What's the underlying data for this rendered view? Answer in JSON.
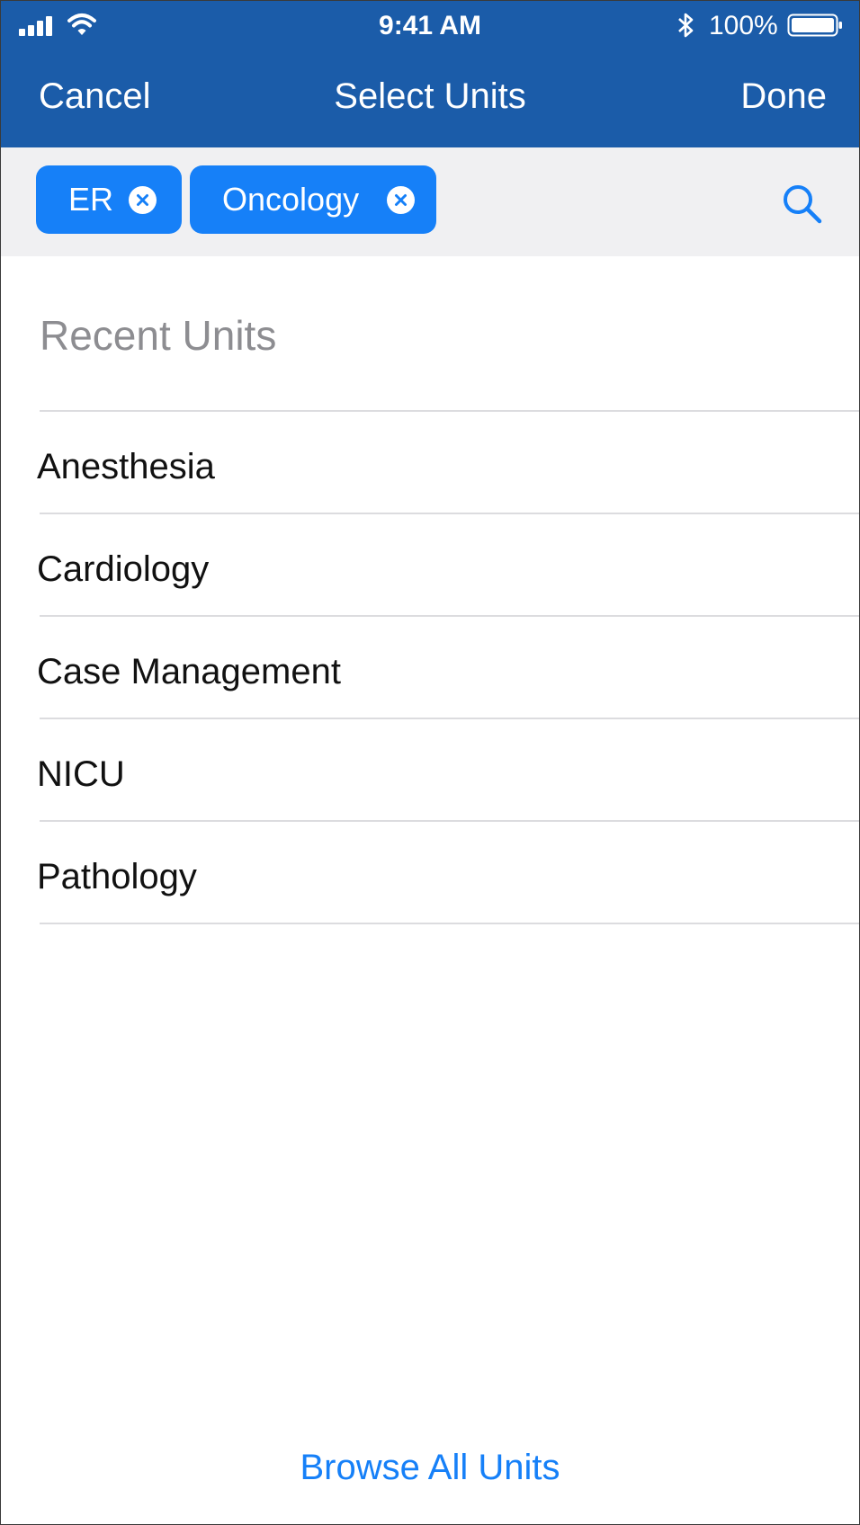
{
  "status_bar": {
    "time": "9:41 AM",
    "battery_percent": "100%",
    "icons": [
      "signal-icon",
      "wifi-icon",
      "bluetooth-icon",
      "battery-icon"
    ]
  },
  "nav": {
    "cancel_label": "Cancel",
    "title": "Select Units",
    "done_label": "Done"
  },
  "selected_units": [
    {
      "label": "ER"
    },
    {
      "label": "Oncology"
    }
  ],
  "recent": {
    "header": "Recent Units",
    "items": [
      {
        "label": "Anesthesia"
      },
      {
        "label": "Cardiology"
      },
      {
        "label": "Case Management"
      },
      {
        "label": "NICU"
      },
      {
        "label": "Pathology"
      }
    ]
  },
  "footer": {
    "browse_label": "Browse All Units"
  },
  "colors": {
    "header_bg": "#1b5ca9",
    "accent": "#1680f8",
    "token_bar_bg": "#f0f0f2",
    "section_header_text": "#8d8d91",
    "separator": "#dcdcdf"
  }
}
